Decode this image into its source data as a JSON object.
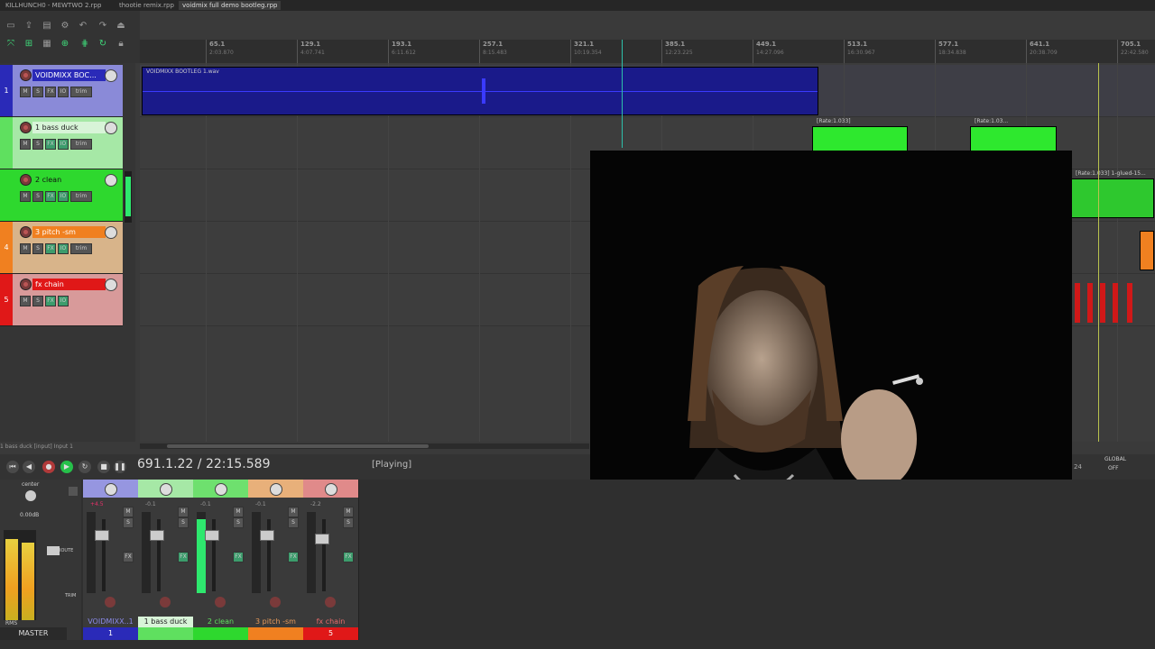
{
  "tabs": [
    {
      "label": "KILLHUNCH0 - MEWTWO 2.rpp",
      "active": false
    },
    {
      "label": "thootie remix.rpp",
      "active": false
    },
    {
      "label": "voidmix full demo bootleg.rpp",
      "active": true
    }
  ],
  "ruler": [
    {
      "bar": "65.1",
      "time": "2:03.870"
    },
    {
      "bar": "129.1",
      "time": "4:07.741"
    },
    {
      "bar": "193.1",
      "time": "6:11.612"
    },
    {
      "bar": "257.1",
      "time": "8:15.483"
    },
    {
      "bar": "321.1",
      "time": "10:19.354"
    },
    {
      "bar": "385.1",
      "time": "12:23.225"
    },
    {
      "bar": "449.1",
      "time": "14:27.096"
    },
    {
      "bar": "513.1",
      "time": "16:30.967"
    },
    {
      "bar": "577.1",
      "time": "18:34.838"
    },
    {
      "bar": "641.1",
      "time": "20:38.709"
    },
    {
      "bar": "705.1",
      "time": "22:42.580"
    }
  ],
  "tracks": [
    {
      "num": "1",
      "name": "VOIDMIXX BOC...",
      "color": "#2a2ab8",
      "tcp_bg": "#8a8ad8"
    },
    {
      "num": "",
      "name": "1 bass duck",
      "color": "#5fe05f",
      "tcp_bg": "#a6e8a6"
    },
    {
      "num": "",
      "name": "2 clean",
      "color": "#2ed82e",
      "tcp_bg": "#2ed82e"
    },
    {
      "num": "4",
      "name": "3 pitch -sm",
      "color": "#f08020",
      "tcp_bg": "#d8b48a"
    },
    {
      "num": "5",
      "name": "fx chain",
      "color": "#e01818",
      "tcp_bg": "#d89a9a"
    }
  ],
  "track_buttons": {
    "m": "M",
    "s": "S",
    "fx": "FX",
    "io": "IO",
    "trim": "trim"
  },
  "items": {
    "main_item": "VOIDMIXX BOOTLEG 1.wav",
    "green_a": "[Rate:1.033]",
    "green_b": "[Rate:1.03...",
    "green_c": "[Rate:1.033] 1-glued-15..."
  },
  "status_line": "1 bass duck [input] Input 1",
  "transport": {
    "time": "691.1.22 / 22:15.589",
    "state": "[Playing]",
    "buttons": [
      "skip-back",
      "back",
      "record",
      "play",
      "loop",
      "stop",
      "pause"
    ]
  },
  "master": {
    "pan_label": "center",
    "volume": "0.00dB",
    "label": "MASTER",
    "rms": "RMS",
    "route": "ROUTE",
    "trim": "TRIM"
  },
  "mixer_strips": [
    {
      "label": "VOIDMIXX..1",
      "num": "1",
      "color": "#2a2ab8",
      "head": "#9696e0",
      "label_color": "#8a8ae8",
      "vol": "+4.5"
    },
    {
      "label": "1 bass duck",
      "num": "",
      "color": "#5fe05f",
      "head": "#a6e8a6",
      "label_color": "#222",
      "vol": "-0.1"
    },
    {
      "label": "2 clean",
      "num": "",
      "color": "#2ed82e",
      "head": "#6ee06e",
      "label_color": "#5fe05f",
      "vol": "-0.1"
    },
    {
      "label": "3 pitch -sm",
      "num": "",
      "color": "#f08020",
      "head": "#e8b07a",
      "label_color": "#e89a5a",
      "vol": "-0.1"
    },
    {
      "label": "fx chain",
      "num": "5",
      "color": "#e01818",
      "head": "#e08a8a",
      "label_color": "#e86a6a",
      "vol": "-2.2"
    }
  ],
  "right_controls": {
    "global": "GLOBAL",
    "off": "OFF",
    "num": "24"
  }
}
